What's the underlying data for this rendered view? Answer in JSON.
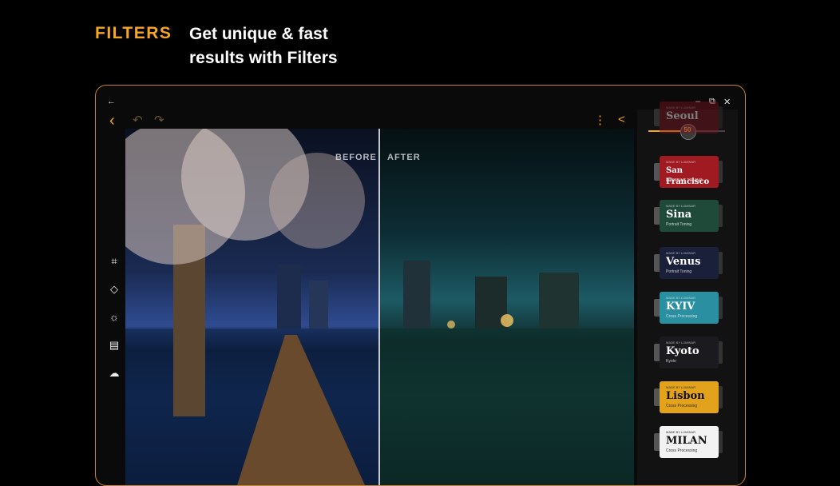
{
  "header": {
    "tag": "FILTERS",
    "headline": "Get unique & fast\nresults with Filters"
  },
  "window": {
    "back_icon": "←",
    "minimize": "–",
    "restore": "⧉",
    "close": "✕"
  },
  "toolbar": {
    "back": "‹",
    "undo": "↶",
    "redo": "↷",
    "more": "⋮",
    "share": "<"
  },
  "tools": [
    {
      "name": "crop-icon",
      "glyph": "⌗"
    },
    {
      "name": "eraser-icon",
      "glyph": "◇"
    },
    {
      "name": "brightness-icon",
      "glyph": "☼"
    },
    {
      "name": "filters-icon",
      "glyph": "▤"
    },
    {
      "name": "weather-icon",
      "glyph": "☁"
    }
  ],
  "compare": {
    "before": "BEFORE",
    "after": "AFTER"
  },
  "slider": {
    "value": "50",
    "fraction": 0.5
  },
  "filters": [
    {
      "name": "Seoul",
      "maker": "MADE BY LUMINAR",
      "sub": "",
      "color": "#7a1320"
    },
    {
      "name": "San Francisco",
      "maker": "MADE BY LUMINAR",
      "sub": "PORTRAIT TONING",
      "color": "#a01a22"
    },
    {
      "name": "Sina",
      "maker": "MADE BY LUMINAR",
      "sub": "Portrait Toning",
      "color": "#1f4a3a"
    },
    {
      "name": "Venus",
      "maker": "MADE BY LUMINAR",
      "sub": "Portrait Toning",
      "color": "#1a1f3a"
    },
    {
      "name": "KYIV",
      "maker": "MADE BY LUMINAR",
      "sub": "Cross Processing",
      "color": "#2a8fa0"
    },
    {
      "name": "Kyoto",
      "maker": "MADE BY LUMINAR",
      "sub": "Kyoto",
      "color": "#1b1b1f"
    },
    {
      "name": "Lisbon",
      "maker": "MADE BY LUMINAR",
      "sub": "Cross Processing",
      "color": "#e3a21c"
    },
    {
      "name": "MILAN",
      "maker": "MADE BY LUMINAR",
      "sub": "Cross Processing",
      "color": "#f2f2f2"
    }
  ]
}
